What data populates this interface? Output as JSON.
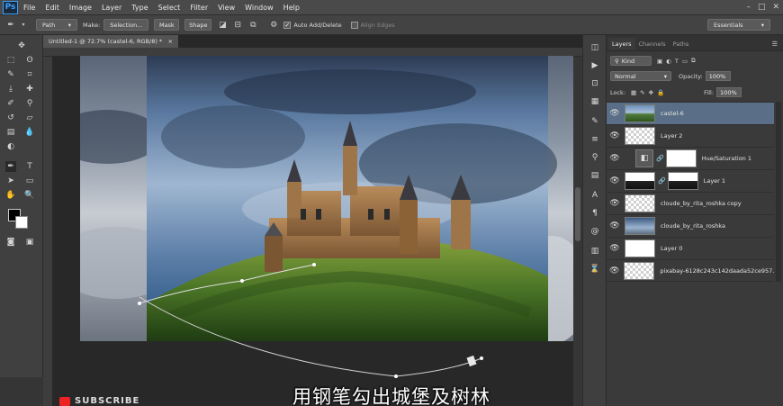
{
  "menubar": {
    "logo": "Ps",
    "items": [
      "File",
      "Edit",
      "Image",
      "Layer",
      "Type",
      "Select",
      "Filter",
      "View",
      "Window",
      "Help"
    ]
  },
  "options_bar": {
    "mode": "Path",
    "make_label": "Make:",
    "selection_btn": "Selection...",
    "mask_btn": "Mask",
    "shape_btn": "Shape",
    "auto_add_delete": "Auto Add/Delete",
    "align_edges": "Align Edges",
    "workspace": "Essentials"
  },
  "document": {
    "tab_title": "Untitled-1 @ 72.7% (castel-6, RGB/8) *",
    "close": "×"
  },
  "panel": {
    "tabs": [
      "Layers",
      "Channels",
      "Paths"
    ],
    "kind_filter": "Kind",
    "blend_mode": "Normal",
    "opacity_label": "Opacity:",
    "opacity_value": "100%",
    "lock_label": "Lock:",
    "fill_label": "Fill:",
    "fill_value": "100%"
  },
  "layers": [
    {
      "name": "castel-6",
      "thumb": "castle",
      "selected": true
    },
    {
      "name": "Layer 2",
      "thumb": "clear"
    },
    {
      "name": "Hue/Saturation 1",
      "thumb": "adj",
      "mask": "white"
    },
    {
      "name": "Layer 1",
      "thumb": "hill",
      "mask": "hill"
    },
    {
      "name": "cloude_by_rita_roshka copy",
      "thumb": "clear"
    },
    {
      "name": "cloude_by_rita_roshka",
      "thumb": "sky"
    },
    {
      "name": "Layer 0",
      "thumb": "white"
    },
    {
      "name": "pixabay-6128c243c142daada52ce957...",
      "thumb": "clear"
    }
  ],
  "subtitle": "用钢笔勾出城堡及树林",
  "subscribe_label": "SUBSCRIBE",
  "colors": {
    "accent_blue": "#3aa0ff",
    "selected_layer": "#5a6f87",
    "subscribe_red": "#e22222"
  }
}
